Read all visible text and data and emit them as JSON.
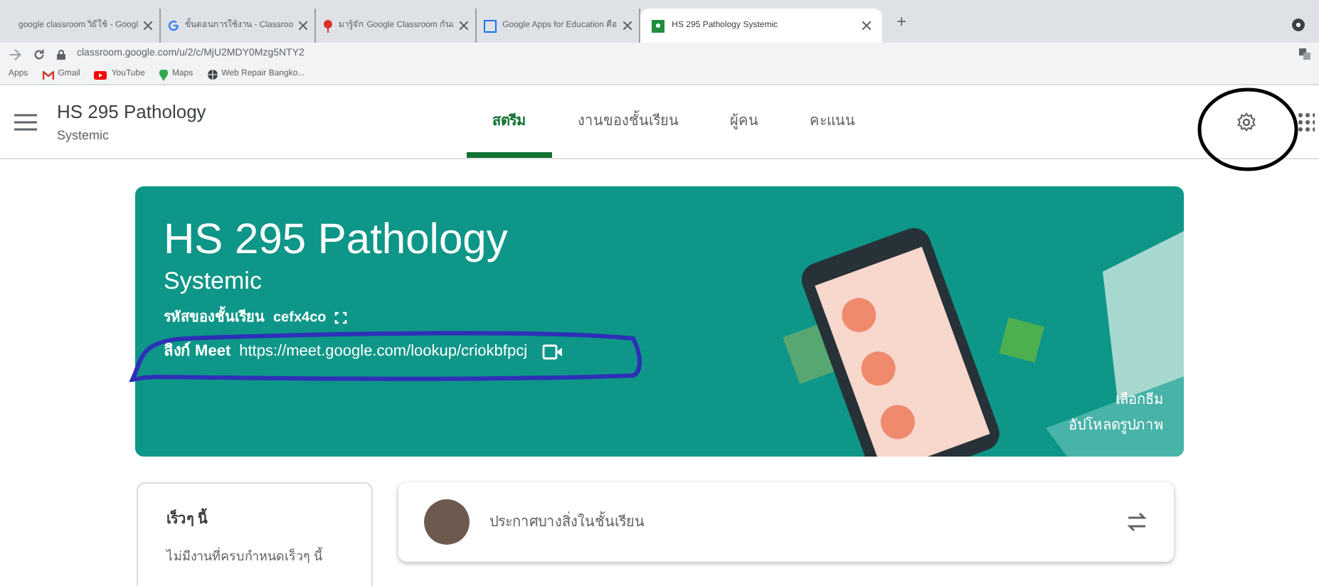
{
  "browser": {
    "tabs": [
      {
        "title": "google classroom วิธีใช้ - Googl",
        "selected": false
      },
      {
        "title": "ขั้นตอนการใช้งาน - Classroo",
        "selected": false
      },
      {
        "title": "มารู้จัก Google Classroom กันเ",
        "selected": false
      },
      {
        "title": "Google Apps for Education คือ",
        "selected": false
      },
      {
        "title": "HS 295 Pathology Systemic",
        "selected": true
      }
    ],
    "new_tab": "+",
    "url": "classroom.google.com/u/2/c/MjU2MDY0Mzg5NTY2",
    "bookmarks": [
      "Apps",
      "Gmail",
      "YouTube",
      "Maps",
      "Web Repair Bangko..."
    ]
  },
  "header": {
    "title": "HS 295 Pathology",
    "subtitle": "Systemic",
    "tabs": [
      {
        "label": "สตรีม",
        "selected": true
      },
      {
        "label": "งานของชั้นเรียน",
        "selected": false
      },
      {
        "label": "ผู้คน",
        "selected": false
      },
      {
        "label": "คะแนน",
        "selected": false
      }
    ]
  },
  "banner": {
    "title": "HS 295 Pathology",
    "subtitle": "Systemic",
    "code_label": "รหัสของชั้นเรียน",
    "code": "cefx4co",
    "meet_label": "ลิงก์ Meet",
    "meet_url": "https://meet.google.com/lookup/criokbfpcj",
    "links": [
      "เลือกธีม",
      "อัปโหลดรูปภาพ"
    ]
  },
  "upcoming": {
    "title": "เร็วๆ นี้",
    "text": "ไม่มีงานที่ครบกำหนดเร็วๆ นี้"
  },
  "announce": {
    "placeholder": "ประกาศบางสิ่งในชั้นเรียน"
  },
  "markup": {
    "settings_circled": true,
    "meet_link_outlined": true
  }
}
